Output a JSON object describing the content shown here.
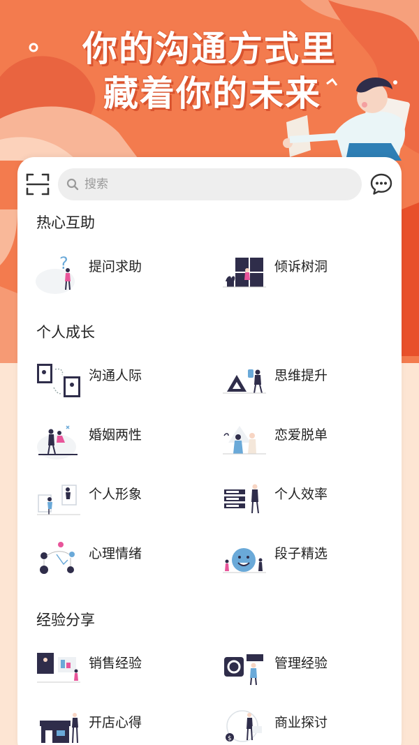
{
  "banner": {
    "line1": "你的沟通方式里",
    "line2": "藏着你的未来",
    "bg_color": "#f47b4f",
    "accent": "#e2552f"
  },
  "search": {
    "placeholder": "搜索",
    "value": ""
  },
  "icons": {
    "left": "scan-icon",
    "search": "search-icon",
    "right": "message-icon"
  },
  "sections": [
    {
      "title": "热心互助",
      "items": [
        {
          "label": "提问求助",
          "icon": "question-figure-illustration"
        },
        {
          "label": "倾诉树洞",
          "icon": "window-plant-illustration"
        }
      ]
    },
    {
      "title": "个人成长",
      "items": [
        {
          "label": "沟通人际",
          "icon": "screens-chat-illustration"
        },
        {
          "label": "思维提升",
          "icon": "triangle-thinking-illustration"
        },
        {
          "label": "婚姻两性",
          "icon": "couple-dancing-illustration"
        },
        {
          "label": "恋爱脱单",
          "icon": "couple-standing-illustration"
        },
        {
          "label": "个人形象",
          "icon": "frames-figure-illustration"
        },
        {
          "label": "个人效率",
          "icon": "task-list-illustration"
        },
        {
          "label": "心理情绪",
          "icon": "emotions-network-illustration"
        },
        {
          "label": "段子精选",
          "icon": "smiley-face-illustration"
        }
      ]
    },
    {
      "title": "经验分享",
      "items": [
        {
          "label": "销售经验",
          "icon": "sales-board-illustration"
        },
        {
          "label": "管理经验",
          "icon": "manager-camera-illustration"
        },
        {
          "label": "开店心得",
          "icon": "shop-owner-illustration"
        },
        {
          "label": "商业探讨",
          "icon": "business-money-illustration"
        }
      ]
    }
  ]
}
